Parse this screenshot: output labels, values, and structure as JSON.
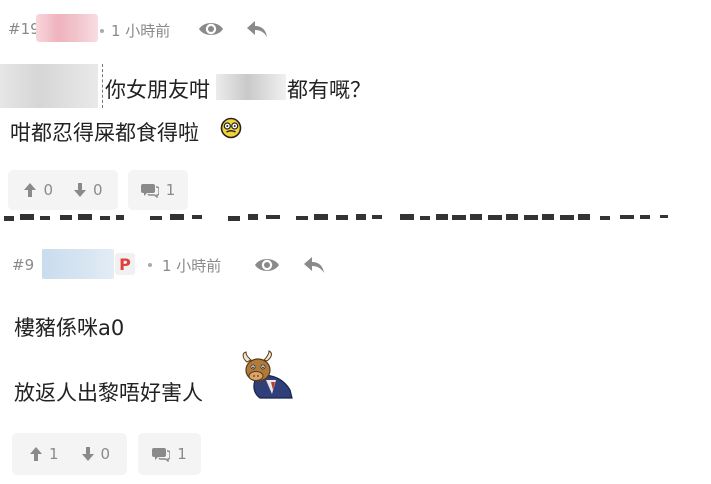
{
  "post1": {
    "number": "#19",
    "time": "1 小時前",
    "line1_a": "你女朋友咁",
    "line1_b": "都有嘅？",
    "line2": "咁都忍得屎都食得啦",
    "upvotes": "0",
    "downvotes": "0",
    "comments": "1"
  },
  "post2": {
    "number": "#9",
    "badge": "P",
    "time": "1 小時前",
    "line1": "樓豬係咪a0",
    "line2": "放返人出黎唔好害人",
    "upvotes": "1",
    "downvotes": "0",
    "comments": "1"
  },
  "icons": {
    "view": "eye-icon",
    "reply": "reply-arrow-icon",
    "up": "arrow-up-icon",
    "down": "arrow-down-icon",
    "comment": "speech-bubble-icon",
    "emoji1": "dizzy-face-emoji",
    "emoji2": "bull-in-suit-sticker"
  },
  "colors": {
    "meta_text": "#8a8a8a",
    "button_bg": "#f4f4f4",
    "badge_red": "#e0403b"
  }
}
